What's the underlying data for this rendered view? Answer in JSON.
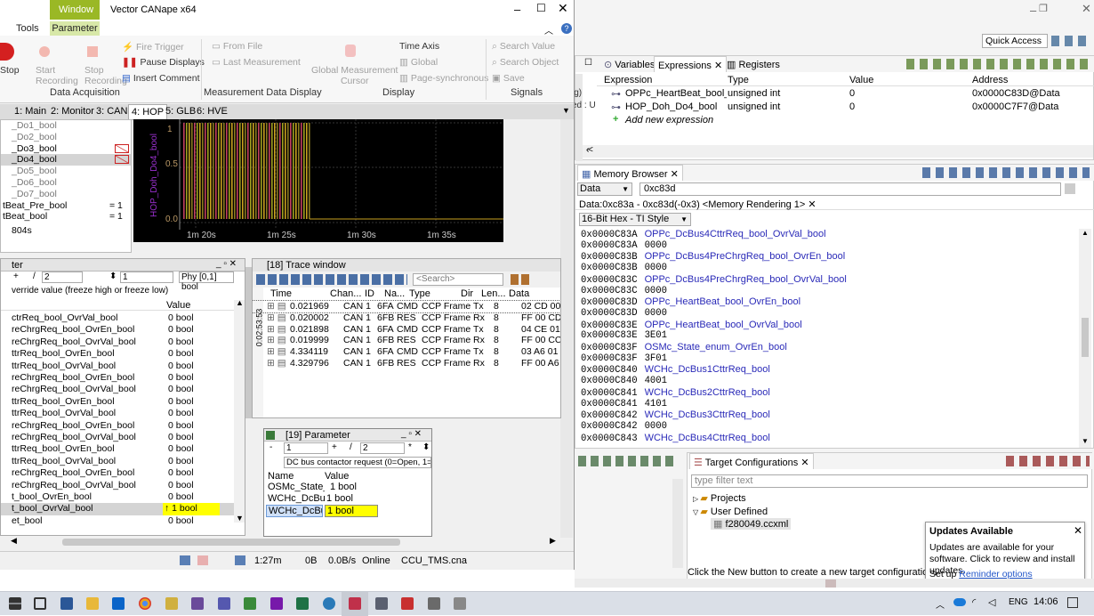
{
  "canape": {
    "title": "Vector CANape x64",
    "ribbon_tabs": [
      "Tools",
      "Window",
      "Parameter"
    ],
    "stop_label": "Stop",
    "buttons": {
      "start_recording": "Start\nRecording",
      "stop_recording": "Stop\nRecording",
      "fire_trigger": "Fire Trigger",
      "pause_displays": "Pause Displays",
      "insert_comment": "Insert Comment",
      "from_file": "From File",
      "last_measurement": "Last Measurement",
      "global_cursor": "Global Measurement\nCursor",
      "time_axis": "Time Axis",
      "global": "Global",
      "page_sync": "Page-synchronous",
      "search_value": "Search Value",
      "search_object": "Search Object",
      "save": "Save"
    },
    "groups": [
      "Data Acquisition",
      "Measurement Data Display",
      "Display",
      "Signals"
    ],
    "window_tabs": [
      "1: Main",
      "2: Monitor",
      "3: CAN",
      "4: HOP",
      "5: GLB",
      "6: HVE"
    ],
    "signal_list": [
      {
        "name": "_Do1_bool",
        "val": ""
      },
      {
        "name": "_Do2_bool",
        "val": ""
      },
      {
        "name": "_Do3_bool",
        "val": ""
      },
      {
        "name": "_Do4_bool",
        "val": ""
      },
      {
        "name": "_Do5_bool",
        "val": ""
      },
      {
        "name": "_Do6_bool",
        "val": ""
      },
      {
        "name": "_Do7_bool",
        "val": ""
      },
      {
        "name": "tBeat_Pre_bool",
        "val": "= 1"
      },
      {
        "name": "tBeat_bool",
        "val": "= 1"
      },
      {
        "name": "804s",
        "val": ""
      }
    ],
    "graph": {
      "y_label": "HOP_Doh_Do4_bool",
      "y_ticks": [
        "1",
        "0.5",
        "0.0"
      ],
      "x_ticks": [
        "1m 20s",
        "1m 25s",
        "1m 30s",
        "1m 35s"
      ]
    },
    "param_window": {
      "title": "ter",
      "field1": "2",
      "field2": "1",
      "field3": "Phy [0,1] bool",
      "description": "verride value (freeze high or freeze low)",
      "col_value": "Value",
      "rows": [
        {
          "name": "ctrReq_bool_OvrVal_bool",
          "value": "0 bool"
        },
        {
          "name": "reChrgReq_bool_OvrEn_bool",
          "value": "0 bool"
        },
        {
          "name": "reChrgReq_bool_OvrVal_bool",
          "value": "0 bool"
        },
        {
          "name": "ttrReq_bool_OvrEn_bool",
          "value": "0 bool"
        },
        {
          "name": "ttrReq_bool_OvrVal_bool",
          "value": "0 bool"
        },
        {
          "name": "reChrgReq_bool_OvrEn_bool",
          "value": "0 bool"
        },
        {
          "name": "reChrgReq_bool_OvrVal_bool",
          "value": "0 bool"
        },
        {
          "name": "ttrReq_bool_OvrEn_bool",
          "value": "0 bool"
        },
        {
          "name": "ttrReq_bool_OvrVal_bool",
          "value": "0 bool"
        },
        {
          "name": "reChrgReq_bool_OvrEn_bool",
          "value": "0 bool"
        },
        {
          "name": "reChrgReq_bool_OvrVal_bool",
          "value": "0 bool"
        },
        {
          "name": "ttrReq_bool_OvrEn_bool",
          "value": "0 bool"
        },
        {
          "name": "ttrReq_bool_OvrVal_bool",
          "value": "0 bool"
        },
        {
          "name": "reChrgReq_bool_OvrEn_bool",
          "value": "0 bool"
        },
        {
          "name": "reChrgReq_bool_OvrVal_bool",
          "value": "0 bool"
        },
        {
          "name": "t_bool_OvrEn_bool",
          "value": "0 bool"
        },
        {
          "name": "t_bool_OvrVal_bool",
          "value": "↑ 1 bool"
        },
        {
          "name": "et_bool",
          "value": "0 bool"
        }
      ]
    },
    "trace": {
      "title": "[18] Trace window",
      "search_placeholder": "<Search>",
      "side_label": "0:02:53:53",
      "headers": [
        "Time",
        "Chan...",
        "ID",
        "Na...",
        "Type",
        "Dir",
        "Len...",
        "Data"
      ],
      "rows": [
        [
          "0.021969",
          "CAN 1",
          "6FA",
          "CMD",
          "CCP Frame",
          "Tx",
          "8",
          "02 CD 00 00"
        ],
        [
          "0.020002",
          "CAN 1",
          "6FB",
          "RES",
          "CCP Frame",
          "Rx",
          "8",
          "FF 00 CD 00"
        ],
        [
          "0.021898",
          "CAN 1",
          "6FA",
          "CMD",
          "CCP Frame",
          "Tx",
          "8",
          "04 CE 01 00"
        ],
        [
          "0.019999",
          "CAN 1",
          "6FB",
          "RES",
          "CCP Frame",
          "Rx",
          "8",
          "FF 00 CC 01"
        ],
        [
          "4.334119",
          "CAN 1",
          "6FA",
          "CMD",
          "CCP Frame",
          "Tx",
          "8",
          "03 A6 01 01"
        ],
        [
          "4.329796",
          "CAN 1",
          "6FB",
          "RES",
          "CCP Frame",
          "Rx",
          "8",
          "FF 00 A6 00"
        ]
      ]
    },
    "param19": {
      "title": "[19] Parameter",
      "field1": "1",
      "field2": "2",
      "description": "DC bus contactor request (0=Open, 1=Close)",
      "col_name": "Name",
      "col_value": "Value",
      "rows": [
        {
          "name": "OSMc_State_e",
          "value": "1 bool"
        },
        {
          "name": "WCHc_DcBus",
          "value": "1 bool"
        },
        {
          "name": "WCHc_DcBus",
          "value": "1 bool"
        }
      ]
    },
    "status": {
      "time": "1:27m",
      "bytes": "0B",
      "rate": "0.0B/s",
      "state": "Online",
      "file": "CCU_TMS.cna"
    }
  },
  "eclipse": {
    "quick_access": "Quick Access",
    "tabs": [
      "Variables",
      "Expressions",
      "Registers"
    ],
    "expr_headers": [
      "Expression",
      "Type",
      "Value",
      "Address"
    ],
    "expressions": [
      {
        "expr": "OPPc_HeartBeat_bool_Ovr",
        "type": "unsigned int",
        "value": "0",
        "address": "0x0000C83D@Data"
      },
      {
        "expr": "HOP_Doh_Do4_bool",
        "type": "unsigned int",
        "value": "0",
        "address": "0x0000C7F7@Data"
      }
    ],
    "add_expression": "Add new expression",
    "left_clip": [
      "ig)",
      "ed : U"
    ],
    "memory_tab": "Memory Browser",
    "memory_space": "Data",
    "memory_address": "0xc83d",
    "rendering_tab": "Data:0xc83a - 0xc83d(-0x3) <Memory Rendering 1>",
    "rendering_format": "16-Bit Hex - TI Style",
    "memory_lines": [
      {
        "addr": "0x0000C83A",
        "text": "OPPc_DcBus4CttrReq_bool_OvrVal_bool",
        "sym": true
      },
      {
        "addr": "0x0000C83A",
        "text": "0000",
        "sym": false
      },
      {
        "addr": "0x0000C83B",
        "text": "OPPc_DcBus4PreChrgReq_bool_OvrEn_bool",
        "sym": true
      },
      {
        "addr": "0x0000C83B",
        "text": "0000",
        "sym": false
      },
      {
        "addr": "0x0000C83C",
        "text": "OPPc_DcBus4PreChrgReq_bool_OvrVal_bool",
        "sym": true
      },
      {
        "addr": "0x0000C83C",
        "text": "0000",
        "sym": false
      },
      {
        "addr": "0x0000C83D",
        "text": "OPPc_HeartBeat_bool_OvrEn_bool",
        "sym": true
      },
      {
        "addr": "0x0000C83D",
        "text": "0000",
        "sym": false
      },
      {
        "addr": "0x0000C83E",
        "text": "OPPc_HeartBeat_bool_OvrVal_bool",
        "sym": true
      },
      {
        "addr": "0x0000C83E",
        "text": "3E01",
        "sym": false
      },
      {
        "addr": "0x0000C83F",
        "text": "OSMc_State_enum_OvrEn_bool",
        "sym": true
      },
      {
        "addr": "0x0000C83F",
        "text": "3F01",
        "sym": false
      },
      {
        "addr": "0x0000C840",
        "text": "WCHc_DcBus1CttrReq_bool",
        "sym": true
      },
      {
        "addr": "0x0000C840",
        "text": "4001",
        "sym": false
      },
      {
        "addr": "0x0000C841",
        "text": "WCHc_DcBus2CttrReq_bool",
        "sym": true
      },
      {
        "addr": "0x0000C841",
        "text": "4101",
        "sym": false
      },
      {
        "addr": "0x0000C842",
        "text": "WCHc_DcBus3CttrReq_bool",
        "sym": true
      },
      {
        "addr": "0x0000C842",
        "text": "0000",
        "sym": false
      },
      {
        "addr": "0x0000C843",
        "text": "WCHc_DcBus4CttrReq_bool",
        "sym": true
      }
    ],
    "target_tab": "Target Configurations",
    "target_filter_placeholder": "type filter text",
    "tree": [
      "Projects",
      "User Defined",
      "f280049.ccxml"
    ],
    "target_hint": "Click the New button to create a new target configuration file. C",
    "updates": {
      "title": "Updates Available",
      "body": "Updates are available for your software. Click to review and install updates.",
      "setup": "Set up",
      "link": "Reminder options"
    }
  },
  "taskbar": {
    "language": "ENG",
    "time": "14:06"
  }
}
